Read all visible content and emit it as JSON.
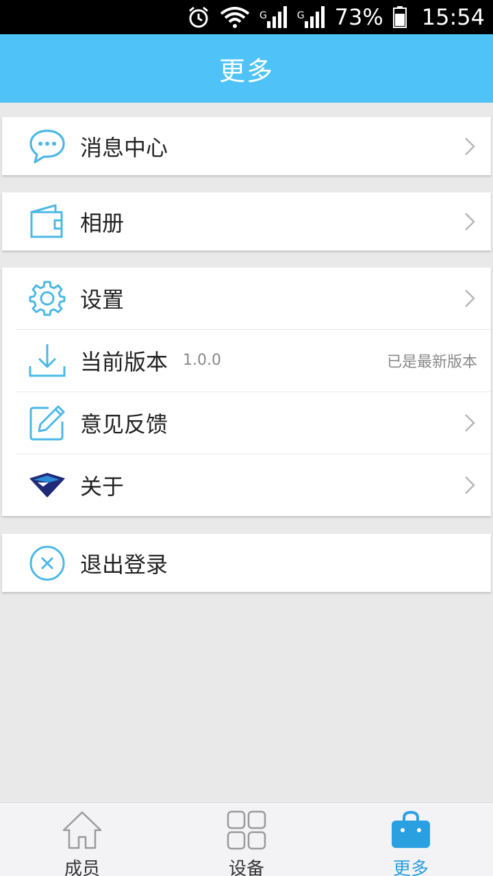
{
  "status_bar": {
    "network_1": "G",
    "network_2": "G",
    "battery": "73%",
    "time": "15:54"
  },
  "header": {
    "title": "更多"
  },
  "menu": {
    "messages": {
      "label": "消息中心"
    },
    "album": {
      "label": "相册"
    },
    "settings": {
      "label": "设置"
    },
    "version": {
      "label": "当前版本",
      "value": "1.0.0",
      "status": "已是最新版本"
    },
    "feedback": {
      "label": "意见反馈"
    },
    "about": {
      "label": "关于"
    },
    "logout": {
      "label": "退出登录"
    }
  },
  "bottom_nav": {
    "members": "成员",
    "devices": "设备",
    "more": "更多"
  },
  "colors": {
    "accent": "#4fc3f7",
    "icon": "#4ab8e6",
    "active_tab": "#2ba0e0"
  }
}
